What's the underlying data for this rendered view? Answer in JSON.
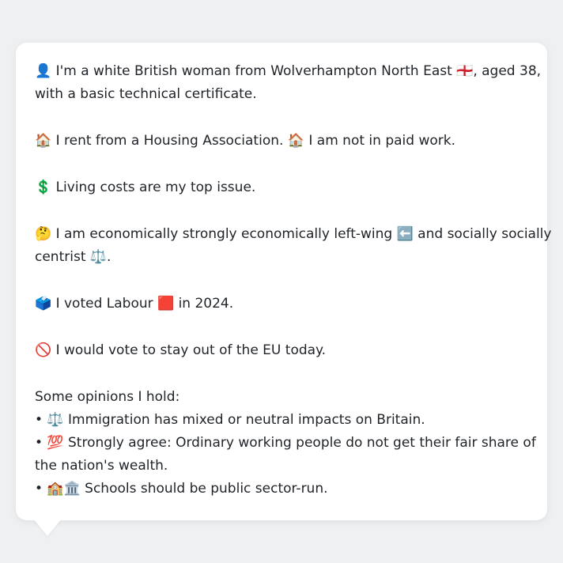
{
  "profile": {
    "intro_line1": "👤 I'm a white British woman from Wolverhampton North East 🏴󠁧󠁢󠁥󠁮󠁧󠁿, aged 38,",
    "intro_line2": "with a basic technical certificate.",
    "housing": "🏠 I rent from a Housing Association. 🏠 I am not in paid work.",
    "issue": "💲 Living costs are my top issue.",
    "ideology_line1": "🤔 I am economically strongly economically left-wing ⬅️ and socially socially",
    "ideology_line2": "centrist ⚖️.",
    "vote": "🗳️ I voted Labour 🟥 in 2024.",
    "eu": "🚫 I would vote to stay out of the EU today."
  },
  "opinions": {
    "heading": "Some opinions I hold:",
    "item1": "• ⚖️ Immigration has mixed or neutral impacts on Britain.",
    "item2_line1": "• 💯 Strongly agree: Ordinary working people do not get their fair share of",
    "item2_line2": "the nation's wealth.",
    "item3": "• 🏫🏛️ Schools should be public sector-run."
  }
}
